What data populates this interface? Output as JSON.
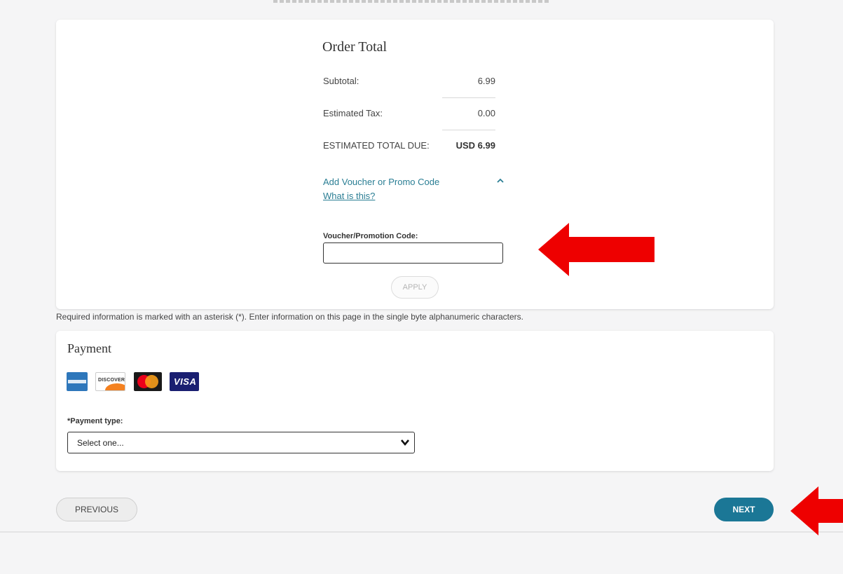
{
  "order_total": {
    "title": "Order Total",
    "subtotal_label": "Subtotal:",
    "subtotal_value": "6.99",
    "tax_label": "Estimated Tax:",
    "tax_value": "0.00",
    "total_label": "ESTIMATED TOTAL DUE:",
    "total_value": "USD 6.99",
    "voucher_link": "Add Voucher or Promo Code",
    "what_link": "What is this?",
    "voucher_label": "Voucher/Promotion Code:",
    "voucher_value": "",
    "apply_label": "APPLY"
  },
  "required_note": "Required information is marked with an asterisk (*). Enter information on this page in the single byte alphanumeric characters.",
  "payment": {
    "title": "Payment",
    "card_brands": [
      "amex-logo",
      "discover-logo",
      "mastercard-logo",
      "visa-logo"
    ],
    "visa_text": "VISA",
    "discover_text": "DISCOVER",
    "type_label": "*Payment type:",
    "type_selected": "Select one..."
  },
  "nav": {
    "previous_label": "PREVIOUS",
    "next_label": "NEXT"
  },
  "colors": {
    "accent": "#1b7796",
    "link": "#2a7e94",
    "annotation_arrow": "#ee0000",
    "background": "#f5f5f6"
  }
}
